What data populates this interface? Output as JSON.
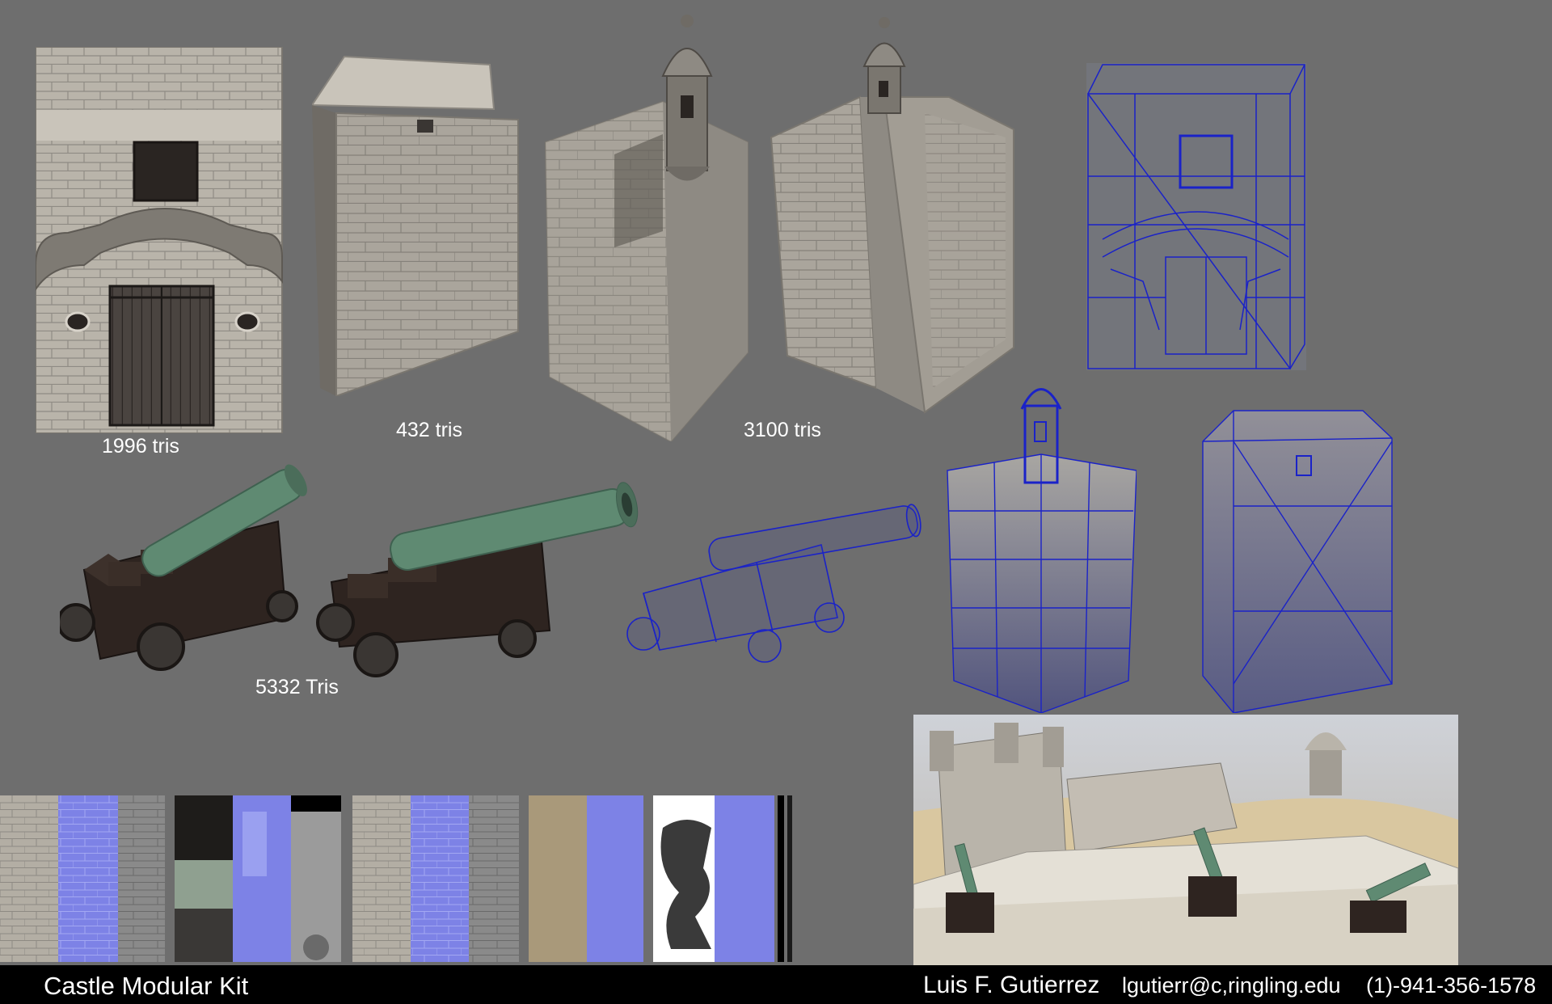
{
  "labels": {
    "gate_tris": "1996 tris",
    "wall_tris": "432 tris",
    "tower_tris": "3100 tris",
    "cannon_tris": "5332 Tris"
  },
  "footer": {
    "title": "Castle Modular Kit",
    "author": "Luis F. Gutierrez",
    "email": "lgutierr@c,ringling.edu",
    "phone": "(1)-941-356-1578"
  },
  "colors": {
    "background": "#6e6e6e",
    "stone": "#b7b2a8",
    "stone_dark": "#8e8a83",
    "wireframe": "#1a22c8",
    "normal_map": "#7d82e6",
    "bronze": "#5f8a72",
    "wood_dark": "#2e2420",
    "footer_bg": "#000000",
    "sand": "#d9c7a0"
  },
  "icons": {
    "gate": "gate-module-icon",
    "wall": "wall-module-icon",
    "tower": "tower-module-icon",
    "cannon": "cannon-icon"
  }
}
